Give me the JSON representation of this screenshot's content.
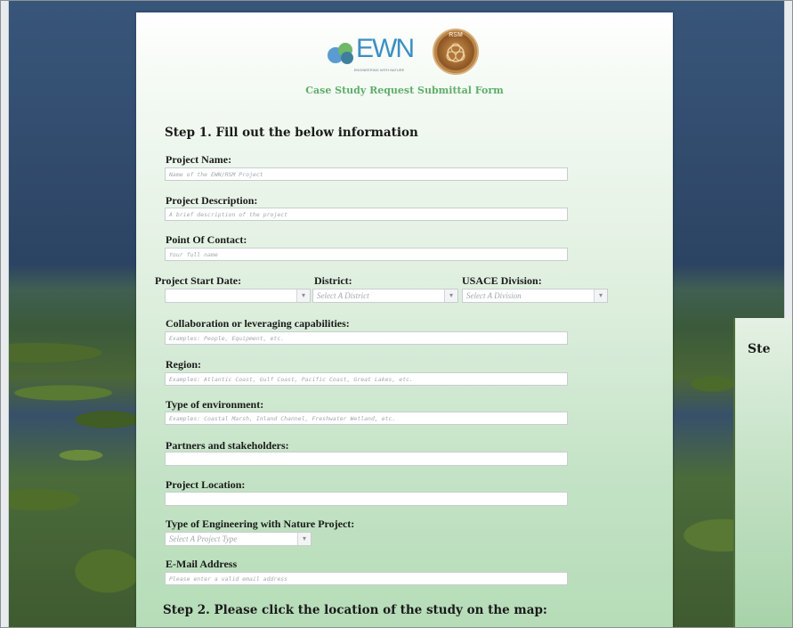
{
  "form": {
    "title": "Case Study Request Submittal Form",
    "step1_heading": "Step 1. Fill out the below information",
    "step2_heading": "Step 2. Please click the location of the study on the map:",
    "fields": {
      "project_name": {
        "label": "Project Name:",
        "placeholder": "Name of the EWN/RSM Project"
      },
      "project_description": {
        "label": "Project Description:",
        "placeholder": "A brief description of the project"
      },
      "point_of_contact": {
        "label": "Point Of Contact:",
        "placeholder": "Your full name"
      },
      "project_start_date": {
        "label": "Project Start Date:",
        "value": ""
      },
      "district": {
        "label": "District:",
        "placeholder": "Select A District"
      },
      "usace_division": {
        "label": "USACE Division:",
        "placeholder": "Select A Division"
      },
      "collaboration": {
        "label": "Collaboration or leveraging capabilities:",
        "placeholder": "Examples: People, Equipment, etc."
      },
      "region": {
        "label": "Region:",
        "placeholder": "Examples: Atlantic Coast, Gulf Coast, Pacific Coast, Great Lakes, etc."
      },
      "environment": {
        "label": "Type of environment:",
        "placeholder": "Examples: Coastal Marsh, Inland Channel, Freshwater Wetland, etc."
      },
      "partners": {
        "label": "Partners and stakeholders:",
        "placeholder": ""
      },
      "location": {
        "label": "Project Location:",
        "placeholder": ""
      },
      "ewn_type": {
        "label": "Type of Engineering with Nature Project:",
        "placeholder": "Select A Project Type"
      },
      "email": {
        "label": "E-Mail Address",
        "placeholder": "Please enter a valid email address"
      }
    }
  },
  "logos": {
    "ewn_text": "EWN",
    "ewn_subtext": "ENGINEERING WITH NATURE",
    "rsm_text": "RSM"
  },
  "side_panel": {
    "text": "Ste"
  },
  "icons": {
    "caret": "▾"
  },
  "colors": {
    "title_green": "#5fae6a",
    "ewn_blue": "#3c8fc3"
  }
}
